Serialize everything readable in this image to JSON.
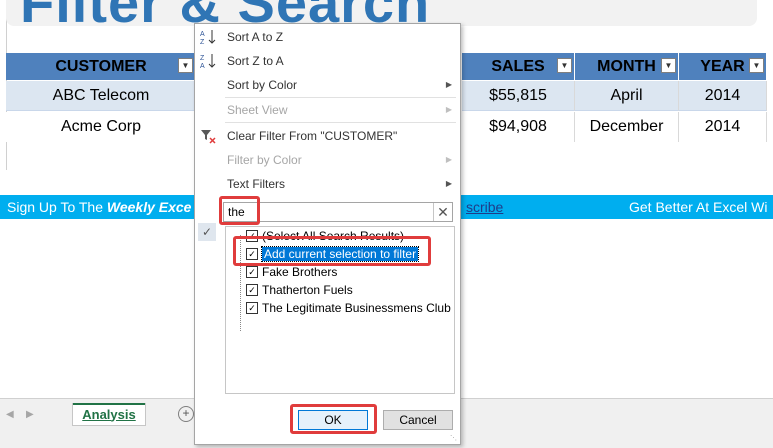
{
  "sheet": {
    "title": "Filter & Search",
    "columns": [
      {
        "label": "CUSTOMER",
        "filtered": true
      },
      {
        "label": "SALES",
        "filtered": false
      },
      {
        "label": "MONTH",
        "filtered": false
      },
      {
        "label": "YEAR",
        "filtered": false
      }
    ],
    "rows": [
      {
        "customer": "ABC Telecom",
        "sales": "$55,815",
        "month": "April",
        "year": "2014"
      },
      {
        "customer": "Acme Corp",
        "sales": "$94,908",
        "month": "December",
        "year": "2014"
      }
    ],
    "banner": {
      "prefix": "Sign Up To The ",
      "bold": "Weekly Exce",
      "link": "scribe",
      "right": "Get Better At Excel Wi"
    },
    "active_tab": "Analysis",
    "colors": {
      "header_bg": "#4f81bd",
      "banner_bg": "#00aeef",
      "title": "#2f75b5",
      "highlight": "#e03c3c"
    }
  },
  "menu": {
    "items": [
      {
        "label": "Sort A to Z",
        "icon": "sort-a-z-icon",
        "disabled": false,
        "submenu": false
      },
      {
        "label": "Sort Z to A",
        "icon": "sort-z-a-icon",
        "disabled": false,
        "submenu": false
      },
      {
        "label": "Sort by Color",
        "icon": "",
        "disabled": false,
        "submenu": true
      },
      {
        "label": "Sheet View",
        "icon": "",
        "disabled": true,
        "submenu": true
      },
      {
        "label": "Clear Filter From \"CUSTOMER\"",
        "icon": "clear-filter-icon",
        "disabled": false,
        "submenu": false
      },
      {
        "label": "Filter by Color",
        "icon": "",
        "disabled": true,
        "submenu": true
      },
      {
        "label": "Text Filters",
        "icon": "",
        "disabled": false,
        "submenu": true
      }
    ],
    "search_value": "the",
    "list": [
      {
        "label": "(Select All Search Results)",
        "checked": true,
        "selected": false
      },
      {
        "label": "Add current selection to filter",
        "checked": true,
        "selected": true
      },
      {
        "label": "Fake Brothers",
        "checked": true,
        "selected": false
      },
      {
        "label": "Thatherton Fuels",
        "checked": true,
        "selected": false
      },
      {
        "label": "The Legitimate Businessmens Club",
        "checked": true,
        "selected": false
      }
    ],
    "ok_label": "OK",
    "cancel_label": "Cancel"
  }
}
